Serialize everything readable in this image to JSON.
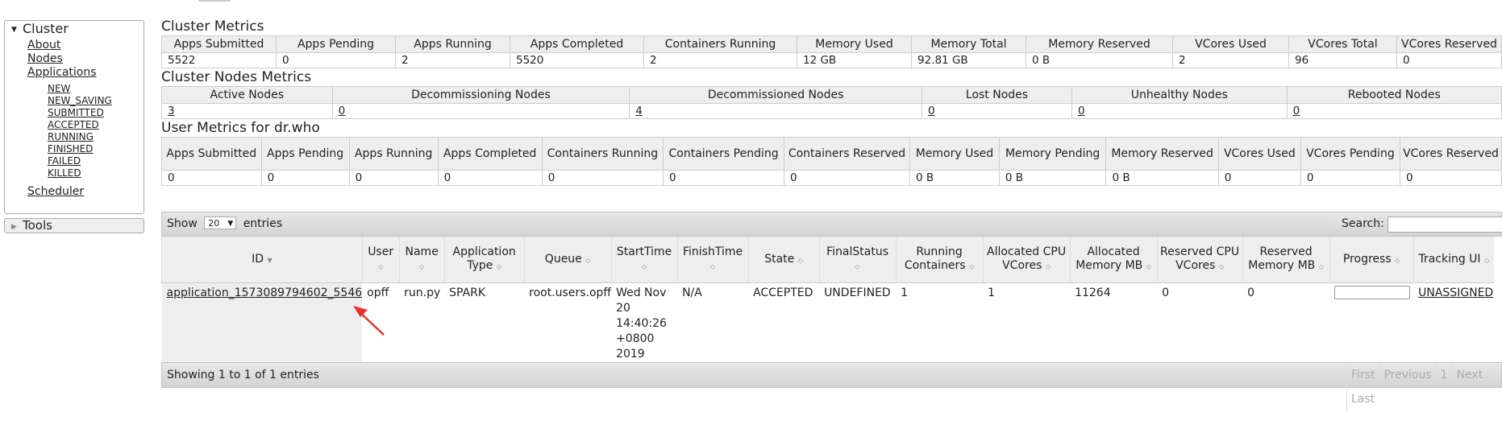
{
  "sidebar": {
    "cluster_label": "Cluster",
    "items": [
      {
        "label": "About"
      },
      {
        "label": "Nodes"
      },
      {
        "label": "Applications"
      }
    ],
    "app_states": [
      "NEW",
      "NEW_SAVING",
      "SUBMITTED",
      "ACCEPTED",
      "RUNNING",
      "FINISHED",
      "FAILED",
      "KILLED"
    ],
    "scheduler_label": "Scheduler",
    "tools_label": "Tools"
  },
  "cluster_metrics": {
    "title": "Cluster Metrics",
    "headers": [
      "Apps Submitted",
      "Apps Pending",
      "Apps Running",
      "Apps Completed",
      "Containers Running",
      "Memory Used",
      "Memory Total",
      "Memory Reserved",
      "VCores Used",
      "VCores Total",
      "VCores Reserved"
    ],
    "values": [
      "5522",
      "0",
      "2",
      "5520",
      "2",
      "12 GB",
      "92.81 GB",
      "0 B",
      "2",
      "96",
      "0"
    ]
  },
  "nodes_metrics": {
    "title": "Cluster Nodes Metrics",
    "headers": [
      "Active Nodes",
      "Decommissioning Nodes",
      "Decommissioned Nodes",
      "Lost Nodes",
      "Unhealthy Nodes",
      "Rebooted Nodes"
    ],
    "values": [
      "3",
      "0",
      "4",
      "0",
      "0",
      "0"
    ]
  },
  "user_metrics": {
    "title": "User Metrics for dr.who",
    "headers": [
      "Apps Submitted",
      "Apps Pending",
      "Apps Running",
      "Apps Completed",
      "Containers Running",
      "Containers Pending",
      "Containers Reserved",
      "Memory Used",
      "Memory Pending",
      "Memory Reserved",
      "VCores Used",
      "VCores Pending",
      "VCores Reserved"
    ],
    "values": [
      "0",
      "0",
      "0",
      "0",
      "0",
      "0",
      "0",
      "0 B",
      "0 B",
      "0 B",
      "0",
      "0",
      "0"
    ]
  },
  "apps_table": {
    "show_label": "Show",
    "page_size": "20",
    "entries_label": "entries",
    "search_label": "Search:",
    "columns": [
      {
        "label": "ID",
        "sort": "▼"
      },
      {
        "label": "User",
        "sort": "◇"
      },
      {
        "label": "Name",
        "sort": "◇"
      },
      {
        "label": "Application Type",
        "sort": "◇"
      },
      {
        "label": "Queue",
        "sort": "◇"
      },
      {
        "label": "StartTime",
        "sort": "◇"
      },
      {
        "label": "FinishTime",
        "sort": "◇"
      },
      {
        "label": "State",
        "sort": "◇"
      },
      {
        "label": "FinalStatus",
        "sort": "◇"
      },
      {
        "label": "Running Containers",
        "sort": "◇"
      },
      {
        "label": "Allocated CPU VCores",
        "sort": "◇"
      },
      {
        "label": "Allocated Memory MB",
        "sort": "◇"
      },
      {
        "label": "Reserved CPU VCores",
        "sort": "◇"
      },
      {
        "label": "Reserved Memory MB",
        "sort": "◇"
      },
      {
        "label": "Progress",
        "sort": "◇"
      },
      {
        "label": "Tracking UI",
        "sort": "◇"
      }
    ],
    "rows": [
      {
        "id": "application_1573089794602_5546",
        "user": "opff",
        "name": "run.py",
        "type": "SPARK",
        "queue": "root.users.opff",
        "start_time": "Wed Nov 20 14:40:26 +0800 2019",
        "finish_time": "N/A",
        "state": "ACCEPTED",
        "final_status": "UNDEFINED",
        "running_containers": "1",
        "alloc_vcores": "1",
        "alloc_memory": "11264",
        "reserved_vcores": "0",
        "reserved_memory": "0",
        "progress": 0,
        "tracking": "UNASSIGNED"
      }
    ],
    "footer_info": "Showing 1 to 1 of 1 entries",
    "pager": [
      "First",
      "Previous",
      "1",
      "Next",
      "Last"
    ]
  },
  "colors": {
    "annotation_arrow": "#e8312a",
    "header_bg": "#eeeeee"
  }
}
